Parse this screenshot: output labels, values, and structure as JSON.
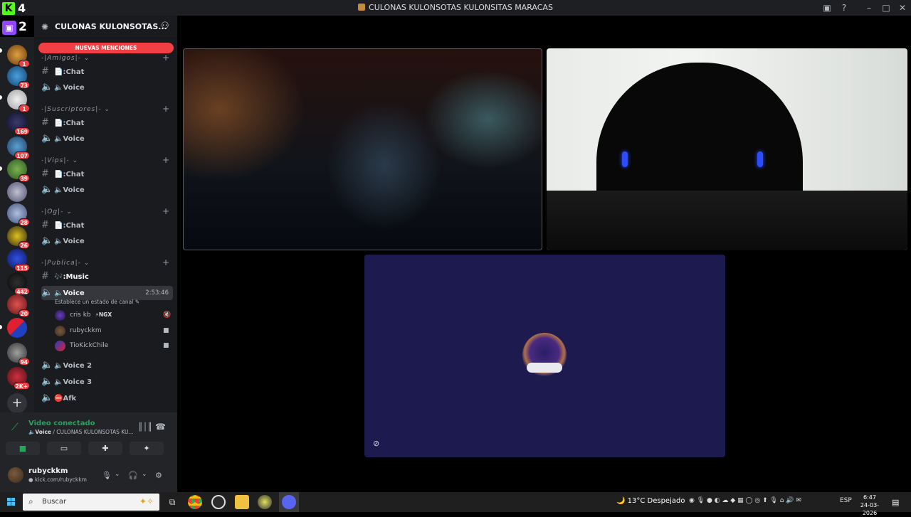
{
  "window": {
    "title": "CULONAS KULONSOTAS KULONSITAS MARACAS",
    "kick_badge": "4",
    "twitch_badge": "2"
  },
  "guilds": {
    "badges": [
      "1",
      "73",
      "1",
      "169",
      "107",
      "39",
      "28",
      "26",
      "115",
      "442",
      "20",
      "94",
      "2K+"
    ]
  },
  "server": {
    "name": "CULONAS KULONSOTAS...",
    "new_mentions": "NUEVAS MENCIONES"
  },
  "categories": [
    {
      "label": "-|𝘈𝘮𝘪𝘨𝘰𝘴|-",
      "channels": [
        ":Chat",
        "Voice"
      ]
    },
    {
      "label": "-|𝘚𝘶𝘴𝘤𝘳𝘪𝘱𝘵𝘰𝘳𝘦𝘴|-",
      "channels": [
        ":Chat",
        "Voice"
      ]
    },
    {
      "label": "-|𝘝𝘪𝘱𝘴|-",
      "channels": [
        ":Chat",
        "Voice"
      ]
    },
    {
      "label": "-|𝘖𝘨|-",
      "channels": [
        ":Chat",
        "Voice"
      ]
    },
    {
      "label": "-|𝘗𝘶𝘣𝘭𝘪𝘤𝘢|-",
      "channels": [
        ":Music",
        "Voice",
        "Voice 2",
        "Voice 3",
        "Afk"
      ]
    }
  ],
  "active_voice": {
    "elapsed": "2:53:46",
    "status_prompt": "Establece un estado de canal",
    "members": [
      {
        "name": "cris kb",
        "tag": "NGX"
      },
      {
        "name": "rubyckkm"
      },
      {
        "name": "TioKickChile"
      }
    ]
  },
  "voice_panel": {
    "status": "Video conectado",
    "channel": "Voice",
    "server": " / CULONAS KULONSOTAS KU..."
  },
  "user": {
    "name": "rubyckkm",
    "status": "kick.com/rubyckkm"
  },
  "taskbar": {
    "search_placeholder": "Buscar",
    "weather": "13°C  Despejado",
    "language": "ESP",
    "time": "6:47",
    "date": "24-03-2026"
  }
}
